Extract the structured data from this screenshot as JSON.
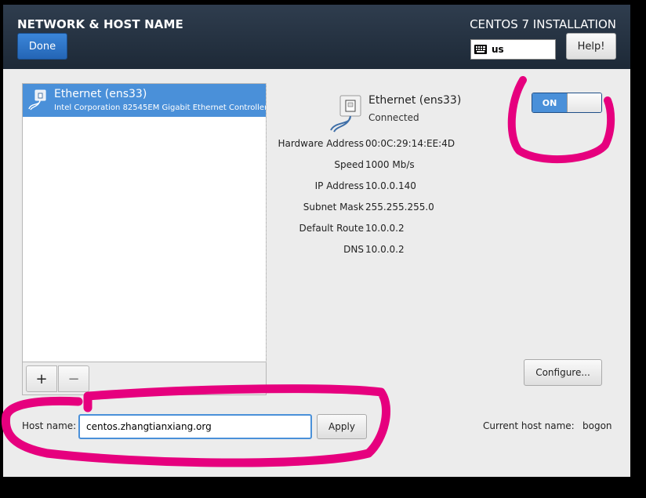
{
  "header": {
    "title": "NETWORK & HOST NAME",
    "done_label": "Done",
    "install_title": "CENTOS 7 INSTALLATION",
    "keyboard_layout": "us",
    "help_label": "Help!"
  },
  "interfaces": [
    {
      "name": "Ethernet (ens33)",
      "description": "Intel Corporation 82545EM Gigabit Ethernet Controller (",
      "selected": true
    }
  ],
  "toolbar": {
    "add_label": "+",
    "remove_label": "−"
  },
  "details": {
    "device_name": "Ethernet (ens33)",
    "status": "Connected",
    "toggle_state": "ON",
    "properties": [
      {
        "label": "Hardware Address",
        "value": "00:0C:29:14:EE:4D"
      },
      {
        "label": "Speed",
        "value": "1000 Mb/s"
      },
      {
        "label": "IP Address",
        "value": "10.0.0.140"
      },
      {
        "label": "Subnet Mask",
        "value": "255.255.255.0"
      },
      {
        "label": "Default Route",
        "value": "10.0.0.2"
      },
      {
        "label": "DNS",
        "value": "10.0.0.2"
      }
    ],
    "configure_label": "Configure..."
  },
  "hostname": {
    "label": "Host name:",
    "value": "centos.zhangtianxiang.org",
    "apply_label": "Apply",
    "current_label": "Current host name:",
    "current_value": "bogon"
  },
  "colors": {
    "accent": "#4a90d9",
    "header_bg": "#26323f",
    "annotation": "#e6007e"
  }
}
